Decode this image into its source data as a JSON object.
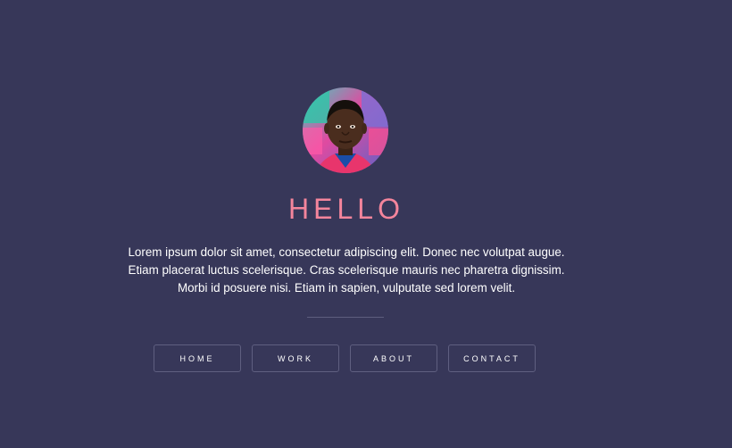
{
  "profile": {
    "avatar_alt": "profile-photo",
    "greeting": "HELLO",
    "bio": "Lorem ipsum dolor sit amet, consectetur adipiscing elit. Donec nec volutpat augue. Etiam placerat luctus scelerisque. Cras scelerisque mauris nec pharetra dignissim. Morbi id posuere nisi. Etiam in sapien, vulputate sed lorem velit."
  },
  "nav": {
    "items": [
      {
        "label": "HOME"
      },
      {
        "label": "WORK"
      },
      {
        "label": "ABOUT"
      },
      {
        "label": "CONTACT"
      }
    ]
  },
  "colors": {
    "background": "#373759",
    "accent": "#f4859c",
    "button_border": "#5f5f80"
  }
}
